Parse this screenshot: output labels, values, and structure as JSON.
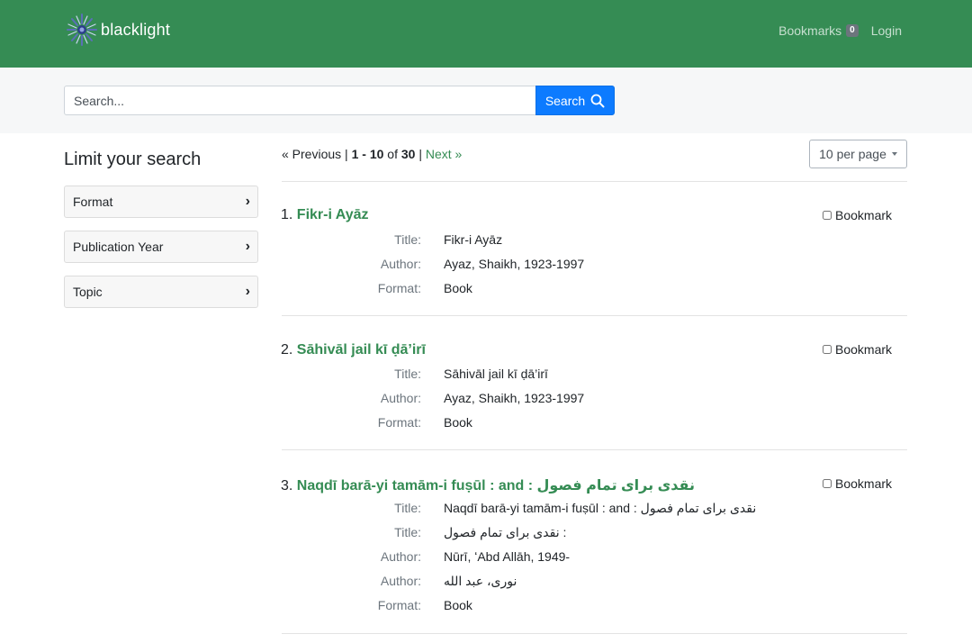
{
  "navbar": {
    "brand": "blacklight",
    "bookmarks_label": "Bookmarks",
    "bookmarks_count": "0",
    "login_label": "Login"
  },
  "search": {
    "placeholder": "Search...",
    "button_label": "Search"
  },
  "sidebar": {
    "title": "Limit your search",
    "facets": [
      {
        "label": "Format"
      },
      {
        "label": "Publication Year"
      },
      {
        "label": "Topic"
      }
    ]
  },
  "results": {
    "previous_label": "« Previous",
    "separator": "|",
    "range_start": "1",
    "range_dash": "-",
    "range_end": "10",
    "of_label": "of",
    "total": "30",
    "next_label": "Next »",
    "per_page_label": "10 per page",
    "bookmark_label": "Bookmark",
    "documents": [
      {
        "number": "1.",
        "title": "Fikr-i Ayāz",
        "fields": [
          {
            "label": "Title:",
            "value": "Fikr-i Ayāz"
          },
          {
            "label": "Author:",
            "value": "Ayaz, Shaikh, 1923-1997"
          },
          {
            "label": "Format:",
            "value": "Book"
          }
        ]
      },
      {
        "number": "2.",
        "title": "Sāhivāl jail kī ḍā’irī",
        "fields": [
          {
            "label": "Title:",
            "value": "Sāhivāl jail kī ḍā’irī"
          },
          {
            "label": "Author:",
            "value": "Ayaz, Shaikh, 1923-1997"
          },
          {
            "label": "Format:",
            "value": "Book"
          }
        ]
      },
      {
        "number": "3.",
        "title": "Naqdī barā-yi tamām-i fuṣūl : and : نقدی برای تمام فصول",
        "fields": [
          {
            "label": "Title:",
            "value": "Naqdī barā-yi tamām-i fuṣūl : and : نقدی برای تمام فصول"
          },
          {
            "label": "Title:",
            "value": "نقدی برای تمام فصول :"
          },
          {
            "label": "Author:",
            "value": "Nūrī, ʻAbd Allāh, 1949-"
          },
          {
            "label": "Author:",
            "value": "نوری، عبد الله"
          },
          {
            "label": "Format:",
            "value": "Book"
          }
        ]
      }
    ]
  }
}
